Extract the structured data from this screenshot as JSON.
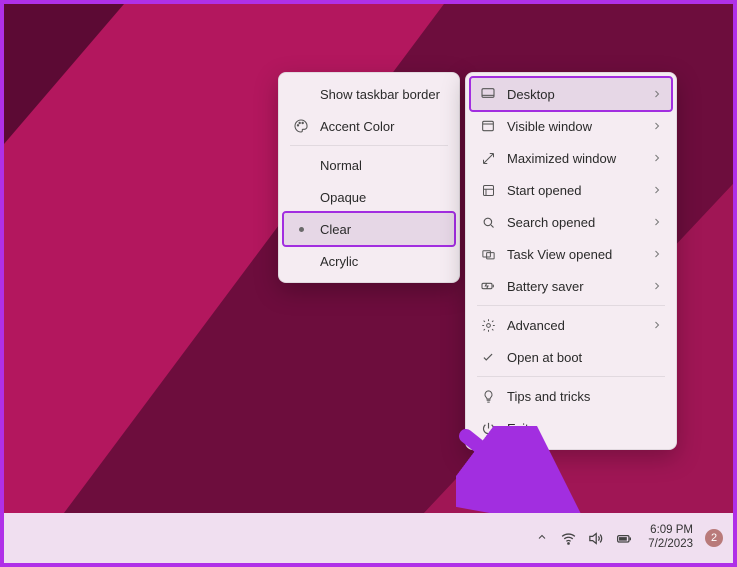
{
  "accent_color": "#a22ee0",
  "left_menu": {
    "items": [
      {
        "label": "Show taskbar border"
      },
      {
        "label": "Accent Color"
      },
      {
        "label": "Normal"
      },
      {
        "label": "Opaque"
      },
      {
        "label": "Clear"
      },
      {
        "label": "Acrylic"
      }
    ]
  },
  "right_menu": {
    "items": [
      {
        "label": "Desktop"
      },
      {
        "label": "Visible window"
      },
      {
        "label": "Maximized window"
      },
      {
        "label": "Start opened"
      },
      {
        "label": "Search opened"
      },
      {
        "label": "Task View opened"
      },
      {
        "label": "Battery saver"
      },
      {
        "label": "Advanced"
      },
      {
        "label": "Open at boot"
      },
      {
        "label": "Tips and tricks"
      },
      {
        "label": "Exit"
      }
    ]
  },
  "taskbar": {
    "time": "6:09 PM",
    "date": "7/2/2023",
    "badge": "2"
  }
}
